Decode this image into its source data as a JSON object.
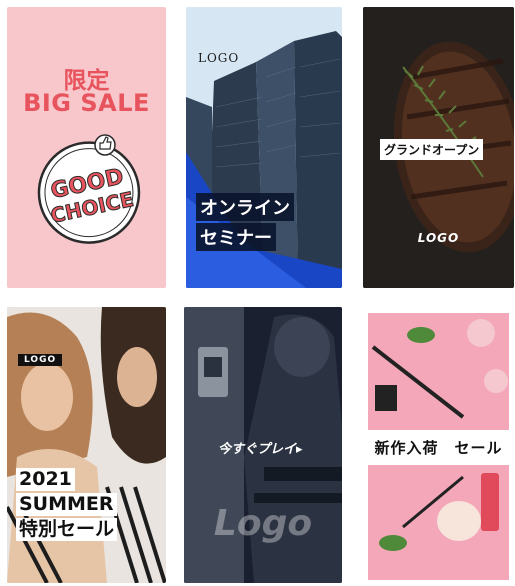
{
  "cards": [
    {
      "id": "big-sale",
      "line1": "限定",
      "line2": "BIG SALE",
      "badge_line1": "GOOD",
      "badge_line2": "CHOICE",
      "colors": {
        "bg": "#f8c7cb",
        "text": "#e8545d"
      }
    },
    {
      "id": "seminar",
      "logo": "LOGO",
      "line1": "オンライン",
      "line2": "セミナー",
      "colors": {
        "accent": "#1a4ec2"
      }
    },
    {
      "id": "grand-open",
      "label": "グランドオープン",
      "logo": "LOGO"
    },
    {
      "id": "summer",
      "logo": "LOGO",
      "line1": "2021",
      "line2": "SUMMER",
      "line3": "特別セール"
    },
    {
      "id": "play",
      "text": "今すぐプレイ▸",
      "logo": "Logo"
    },
    {
      "id": "new-arrival",
      "text": "新作入荷　セール",
      "colors": {
        "bg": "#f4a7b9"
      }
    }
  ]
}
